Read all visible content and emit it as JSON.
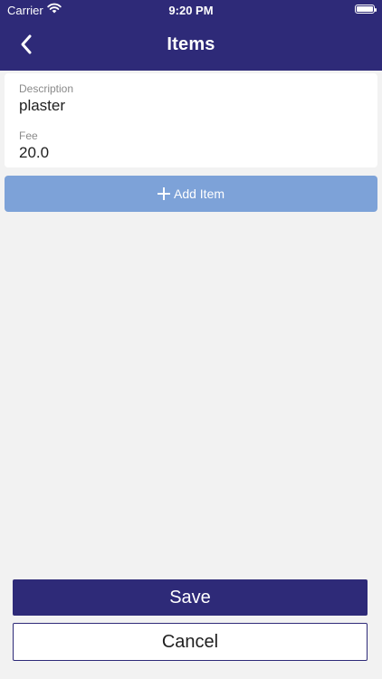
{
  "status_bar": {
    "carrier": "Carrier",
    "time": "9:20 PM"
  },
  "header": {
    "title": "Items"
  },
  "item": {
    "description_label": "Description",
    "description_value": "plaster",
    "fee_label": "Fee",
    "fee_value": "20.0"
  },
  "add_item_label": "Add Item",
  "footer": {
    "save_label": "Save",
    "cancel_label": "Cancel"
  },
  "colors": {
    "primary": "#2e2a78",
    "add_button": "#7da2d8",
    "background": "#f2f2f2"
  },
  "icons": {
    "back": "chevron-left-icon",
    "add": "plus-icon",
    "wifi": "wifi-icon",
    "battery": "battery-icon"
  }
}
